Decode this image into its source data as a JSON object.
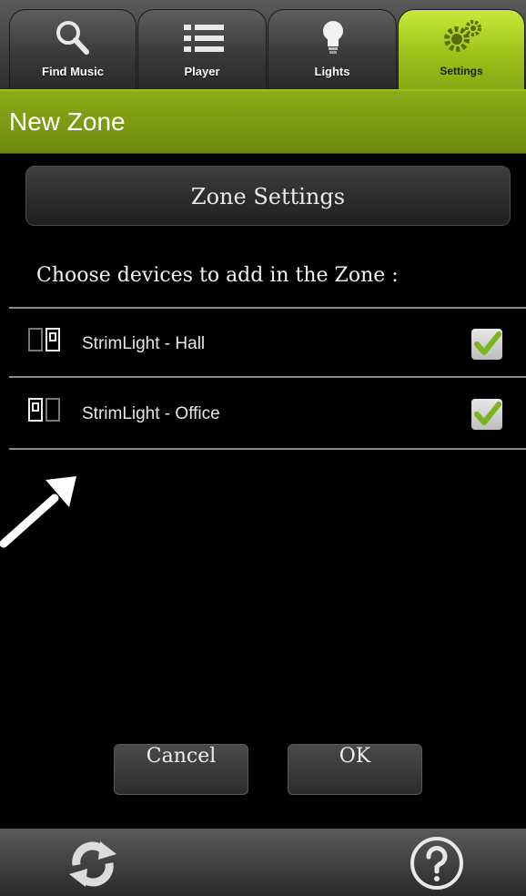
{
  "tabs": [
    {
      "label": "Find Music",
      "icon": "search-icon"
    },
    {
      "label": "Player",
      "icon": "list-icon"
    },
    {
      "label": "Lights",
      "icon": "lightbulb-icon"
    },
    {
      "label": "Settings",
      "icon": "gear-icon",
      "active": true
    }
  ],
  "header": {
    "title": "New Zone"
  },
  "zone_settings_label": "Zone Settings",
  "choose_text": "Choose devices to add in the Zone :",
  "devices": [
    {
      "label": "StrimLight - Hall",
      "icon": "device-pair-icon",
      "checked": true
    },
    {
      "label": "StrimLight - Office",
      "icon": "device-pair-icon",
      "checked": true
    }
  ],
  "buttons": {
    "cancel": "Cancel",
    "ok": "OK"
  },
  "bottom": {
    "refresh_icon": "refresh-icon",
    "help_icon": "help-icon"
  },
  "colors": {
    "accent": "#9ec21a",
    "header": "#7f9c13",
    "check": "#7ab51d"
  }
}
